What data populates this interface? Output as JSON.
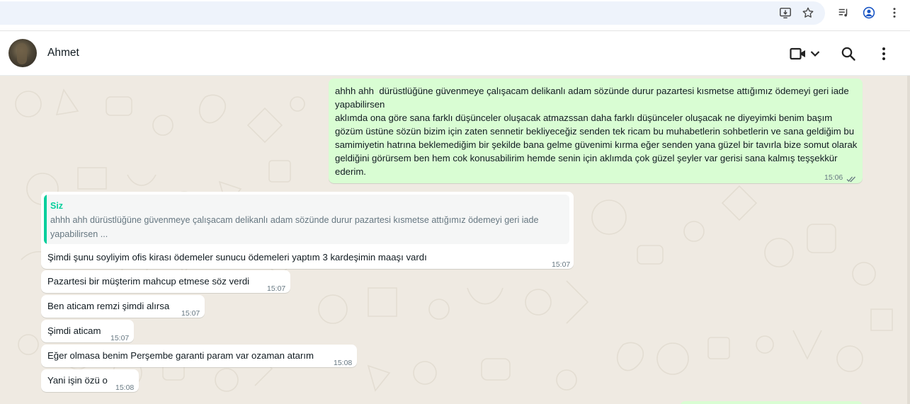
{
  "browser": {
    "icons": [
      "install-app-icon",
      "bookmark-star-icon",
      "media-control-icon",
      "profile-icon",
      "browser-menu-icon"
    ]
  },
  "header": {
    "contact_name": "Ahmet",
    "icons": [
      "video-call-icon",
      "chevron-down-icon",
      "search-icon",
      "menu-kebab-icon"
    ]
  },
  "messages": {
    "outgoing_1": {
      "text": "ahhh ahh  dürüstlüğüne güvenmeye çalışacam delikanlı adam sözünde durur pazartesi kısmetse attığımız ödemeyi geri iade  yapabilirsen\naklımda ona göre sana farklı düşünceler oluşacak atmazssan daha farklı düşünceler oluşacak ne diyeyimki benim başım gözüm üstüne sözün bizim için zaten sennetir bekliyeceğiz senden tek ricam bu muhabetlerin sohbetlerin ve sana geldiğim bu samimiyetin hatrına beklemediğim bir şekilde bana gelme güvenimi kırma eğer senden yana güzel bir tavırla bize somut olarak geldiğini görürsem ben hem cok konusabilirim hemde senin için aklımda çok güzel şeyler var gerisi sana kalmış teşşekkür ederim.",
      "time": "15:06",
      "status": "read"
    },
    "reply": {
      "quote_author": "Siz",
      "quote_text": "ahhh ahh  dürüstlüğüne güvenmeye çalışacam delikanlı adam sözünde durur pazartesi kısmetse attığımız ödemeyi geri iade yapabilirsen ...",
      "text": "Şimdi şunu soyliyim ofis kirası ödemeler sunucu ödemeleri yaptım 3 kardeşimin maaşı vardı",
      "time": "15:07"
    },
    "incoming": [
      {
        "text": "Pazartesi bir müşterim mahcup etmese söz verdi",
        "time": "15:07"
      },
      {
        "text": "Ben aticam remzi şimdi alırsa",
        "time": "15:07"
      },
      {
        "text": "Şimdi aticam",
        "time": "15:07"
      },
      {
        "text": "Eğer olmasa benim Perşembe garanti param var ozaman atarım",
        "time": "15:08"
      },
      {
        "text": "Yani işin özü o",
        "time": "15:08"
      }
    ]
  },
  "colors": {
    "outgoing_bubble": "#d9fdd3",
    "incoming_bubble": "#ffffff",
    "chat_background": "#efeae2",
    "quote_accent": "#06cf9c",
    "read_ticks": "#667781"
  }
}
